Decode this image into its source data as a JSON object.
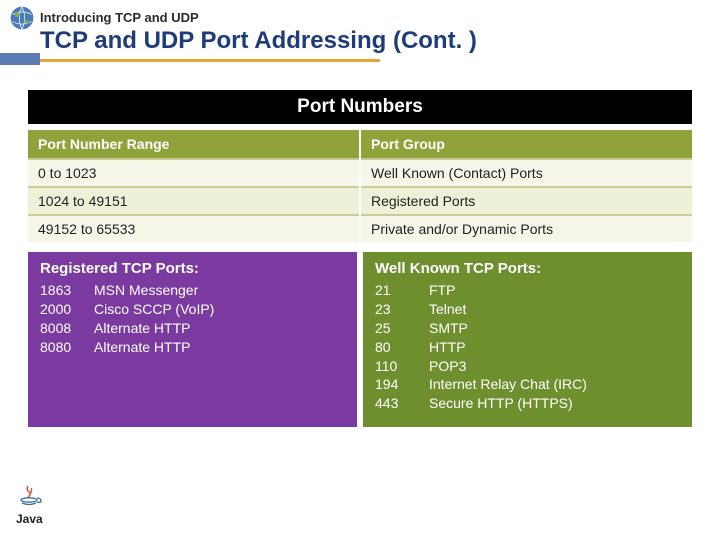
{
  "header": {
    "small": "Introducing TCP and UDP",
    "main": "TCP and UDP Port Addressing (Cont. )"
  },
  "section_title": "Port Numbers",
  "range_table": {
    "headers": {
      "col1": "Port Number Range",
      "col2": "Port Group"
    },
    "rows": [
      {
        "range": "0 to 1023",
        "group": "Well Known (Contact) Ports"
      },
      {
        "range": "1024 to 49151",
        "group": "Registered Ports"
      },
      {
        "range": "49152 to 65533",
        "group": "Private and/or Dynamic Ports"
      }
    ]
  },
  "registered_panel": {
    "title": "Registered TCP Ports:",
    "ports": [
      {
        "num": "1863",
        "name": "MSN Messenger"
      },
      {
        "num": "2000",
        "name": "Cisco SCCP (VoIP)"
      },
      {
        "num": "8008",
        "name": "Alternate HTTP"
      },
      {
        "num": "8080",
        "name": "Alternate HTTP"
      }
    ]
  },
  "wellknown_panel": {
    "title": "Well Known TCP Ports:",
    "ports": [
      {
        "num": "21",
        "name": "FTP"
      },
      {
        "num": "23",
        "name": "Telnet"
      },
      {
        "num": "25",
        "name": "SMTP"
      },
      {
        "num": "80",
        "name": "HTTP"
      },
      {
        "num": "110",
        "name": "POP3"
      },
      {
        "num": "194",
        "name": "Internet Relay Chat (IRC)"
      },
      {
        "num": "443",
        "name": "Secure HTTP (HTTPS)"
      }
    ]
  },
  "logo_text": "Java"
}
